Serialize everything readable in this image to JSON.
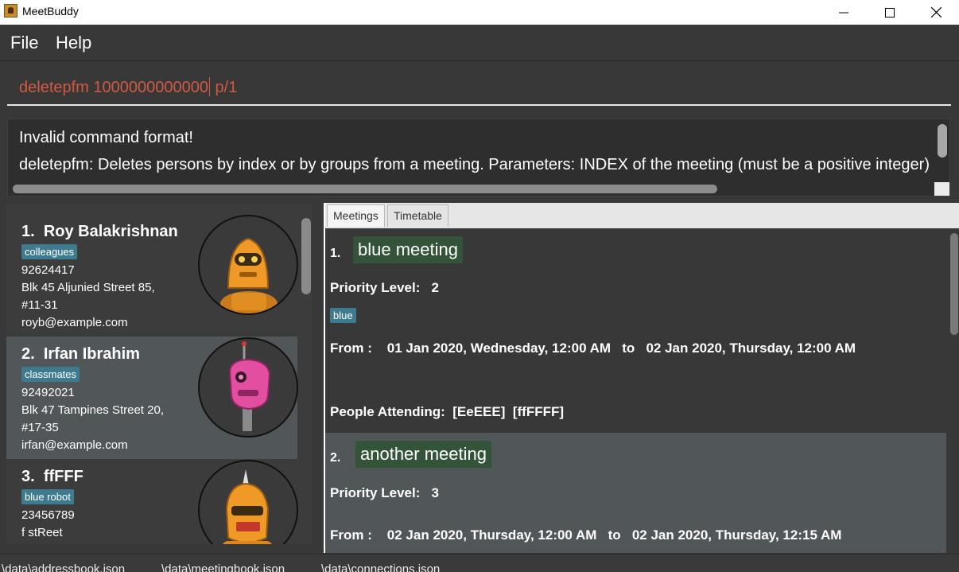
{
  "window": {
    "title": "MeetBuddy"
  },
  "menu": {
    "file": "File",
    "help": "Help"
  },
  "command": {
    "before_caret": "deletepfm 1000000000000",
    "after_caret": " p/1"
  },
  "result": {
    "line1": "Invalid command format!",
    "line2": "deletepfm: Deletes persons by index or by groups from a meeting. Parameters: INDEX of the meeting (must be a positive integer)"
  },
  "persons": [
    {
      "index": "1.",
      "name": "Roy Balakrishnan",
      "tag": "colleagues",
      "phone": "92624417",
      "address1": "Blk 45 Aljunied Street 85,",
      "address2": "#11-31",
      "email": "royb@example.com"
    },
    {
      "index": "2.",
      "name": "Irfan Ibrahim",
      "tag": "classmates",
      "phone": "92492021",
      "address1": "Blk 47 Tampines Street 20,",
      "address2": "#17-35",
      "email": "irfan@example.com"
    },
    {
      "index": "3.",
      "name": "ffFFF",
      "tag": "blue robot",
      "phone": "23456789",
      "address1": "f stReet"
    }
  ],
  "tabs": {
    "meetings": "Meetings",
    "timetable": "Timetable"
  },
  "meetings": [
    {
      "index": "1.",
      "name": "blue meeting",
      "priority_label": "Priority Level:",
      "priority": "2",
      "tag": "blue",
      "from_label": "From :",
      "from": "01 Jan 2020, Wednesday, 12:00 AM",
      "to_label": "to",
      "to": "02 Jan 2020, Thursday, 12:00 AM",
      "attending_label": "People Attending:",
      "attendees": [
        "[EeEEE]",
        "[ffFFFF]"
      ]
    },
    {
      "index": "2.",
      "name": "another meeting",
      "priority_label": "Priority Level:",
      "priority": "3",
      "from_label": "From :",
      "from": "02 Jan 2020, Thursday, 12:00 AM",
      "to_label": "to",
      "to": "02 Jan 2020, Thursday, 12:15 AM"
    }
  ],
  "status": {
    "addressbook": "\\data\\addressbook.json",
    "meetingbook": "\\data\\meetingbook.json",
    "connections": "\\data\\connections.json"
  },
  "icons": {
    "app": "meetbuddy-logo-icon",
    "minimize": "minimize-icon",
    "maximize": "maximize-icon",
    "close": "close-icon"
  },
  "colors": {
    "command_text": "#d05a41",
    "tag_bg": "#3e7b91",
    "meeting_name_bg": "#34543a",
    "selected_card_bg": "#515658"
  }
}
